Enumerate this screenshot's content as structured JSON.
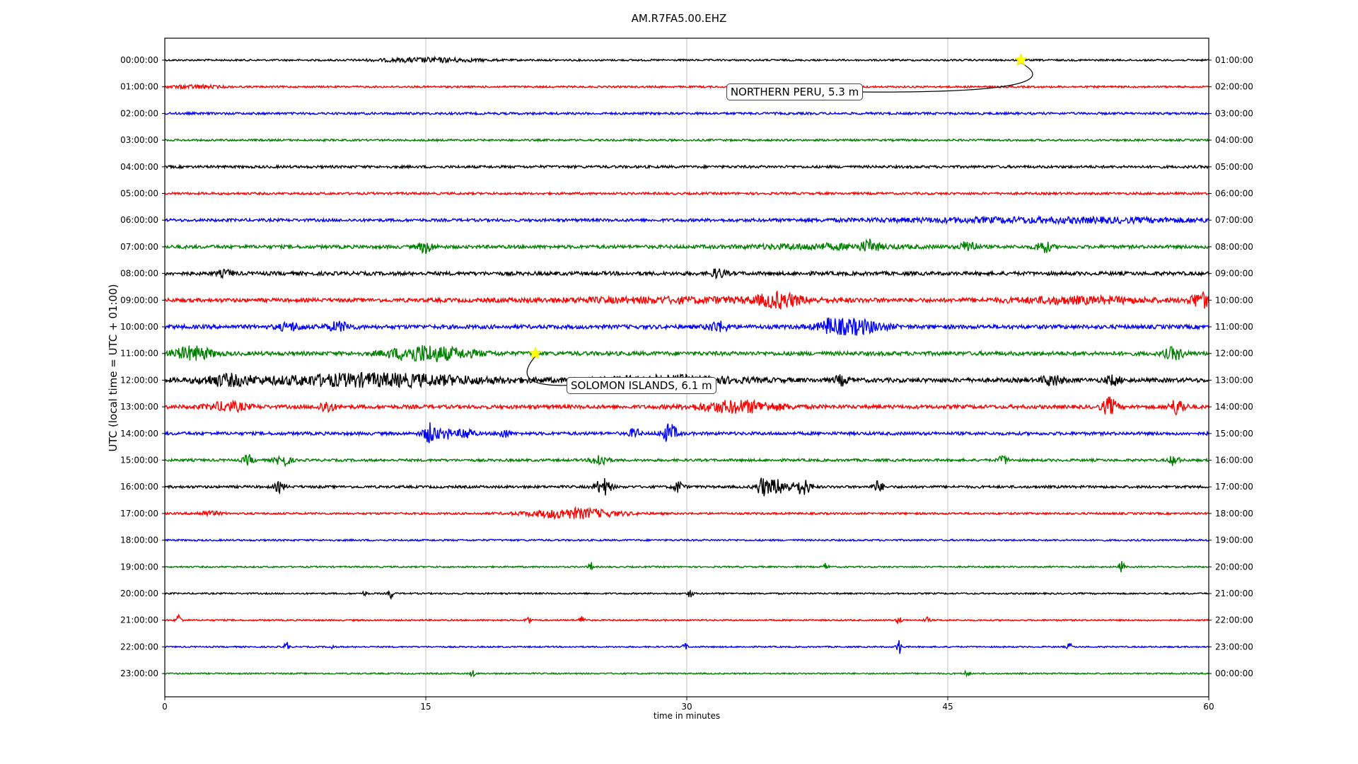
{
  "chart_data": {
    "type": "line",
    "title": "AM.R7FA5.00.EHZ",
    "xlabel": "time in minutes",
    "ylabel": "UTC (local time = UTC + 01:00)",
    "xlim": [
      0,
      60
    ],
    "xticks": [
      0,
      15,
      30,
      45,
      60
    ],
    "grid": "vertical",
    "left_labels": [
      "00:00:00",
      "01:00:00",
      "02:00:00",
      "03:00:00",
      "04:00:00",
      "05:00:00",
      "06:00:00",
      "07:00:00",
      "08:00:00",
      "09:00:00",
      "10:00:00",
      "11:00:00",
      "12:00:00",
      "13:00:00",
      "14:00:00",
      "15:00:00",
      "16:00:00",
      "17:00:00",
      "18:00:00",
      "19:00:00",
      "20:00:00",
      "21:00:00",
      "22:00:00",
      "23:00:00"
    ],
    "right_labels": [
      "01:00:00",
      "02:00:00",
      "03:00:00",
      "04:00:00",
      "05:00:00",
      "06:00:00",
      "07:00:00",
      "08:00:00",
      "09:00:00",
      "10:00:00",
      "11:00:00",
      "12:00:00",
      "13:00:00",
      "14:00:00",
      "15:00:00",
      "16:00:00",
      "17:00:00",
      "18:00:00",
      "19:00:00",
      "20:00:00",
      "21:00:00",
      "22:00:00",
      "23:00:00",
      "00:00:00"
    ],
    "trace_colors": [
      "#000000",
      "#ff0000",
      "#0000ff",
      "#008000"
    ],
    "traces": [
      {
        "noise": 1.2,
        "events": [
          [
            15.2,
            2,
            3
          ]
        ]
      },
      {
        "noise": 1.3,
        "events": [
          [
            1.8,
            1,
            2
          ]
        ]
      },
      {
        "noise": 1.6,
        "events": []
      },
      {
        "noise": 1.4,
        "events": []
      },
      {
        "noise": 1.8,
        "events": []
      },
      {
        "noise": 1.6,
        "events": []
      },
      {
        "noise": 2.0,
        "events": [
          [
            51,
            8,
            3
          ]
        ]
      },
      {
        "noise": 2.4,
        "events": [
          [
            15,
            0.3,
            8
          ],
          [
            40.5,
            0.3,
            7
          ],
          [
            46.2,
            0.3,
            9
          ],
          [
            50.5,
            0.3,
            8
          ],
          [
            38,
            3,
            3
          ]
        ]
      },
      {
        "noise": 2.6,
        "events": [
          [
            31.8,
            0.3,
            6
          ],
          [
            3.5,
            0.3,
            4
          ]
        ]
      },
      {
        "noise": 2.6,
        "events": [
          [
            35.3,
            0.8,
            9
          ],
          [
            59.6,
            0.5,
            10
          ],
          [
            52.5,
            3,
            4
          ],
          [
            30,
            6,
            3
          ]
        ]
      },
      {
        "noise": 2.8,
        "events": [
          [
            39.5,
            1.2,
            10
          ],
          [
            10,
            0.5,
            6
          ],
          [
            31.8,
            0.4,
            7
          ],
          [
            7.2,
            0.5,
            5
          ],
          [
            38.2,
            0.3,
            6
          ]
        ]
      },
      {
        "noise": 2.8,
        "events": [
          [
            1.6,
            0.8,
            9
          ],
          [
            14.5,
            1.2,
            8
          ],
          [
            16.2,
            1.5,
            5
          ],
          [
            58,
            0.4,
            8
          ]
        ]
      },
      {
        "noise": 3.0,
        "events": [
          [
            12,
            4.5,
            8
          ],
          [
            51,
            0.4,
            7
          ],
          [
            54.5,
            0.3,
            6
          ],
          [
            3.5,
            1,
            6
          ],
          [
            29,
            3,
            5
          ],
          [
            38.9,
            0.3,
            6
          ]
        ]
      },
      {
        "noise": 2.6,
        "events": [
          [
            33,
            1.7,
            8
          ],
          [
            54.3,
            0.3,
            12
          ],
          [
            58.2,
            0.3,
            11
          ],
          [
            3.6,
            0.8,
            6
          ],
          [
            9.3,
            0.3,
            8
          ]
        ]
      },
      {
        "noise": 2.2,
        "events": [
          [
            15.3,
            0.3,
            14
          ],
          [
            17.3,
            0.3,
            8
          ],
          [
            29,
            0.3,
            13
          ],
          [
            16.2,
            0.2,
            8
          ],
          [
            27,
            0.2,
            7
          ],
          [
            19.5,
            0.2,
            6
          ]
        ]
      },
      {
        "noise": 1.8,
        "events": [
          [
            6.8,
            0.3,
            8
          ],
          [
            25,
            0.3,
            9
          ],
          [
            4.8,
            0.2,
            7
          ],
          [
            58,
            0.2,
            7
          ],
          [
            48.2,
            0.2,
            6
          ]
        ]
      },
      {
        "noise": 1.8,
        "events": [
          [
            25.2,
            0.3,
            12
          ],
          [
            35.2,
            0.6,
            10
          ],
          [
            36.7,
            0.3,
            11
          ],
          [
            6.6,
            0.2,
            7
          ],
          [
            29.5,
            0.2,
            8
          ],
          [
            34.3,
            0.2,
            10
          ],
          [
            41,
            0.2,
            8
          ]
        ]
      },
      {
        "noise": 1.4,
        "events": [
          [
            23.5,
            1.8,
            7
          ],
          [
            2.5,
            0.5,
            3
          ]
        ]
      },
      {
        "noise": 1.2,
        "events": []
      },
      {
        "noise": 1.1,
        "events": [
          [
            24.5,
            0.1,
            6
          ],
          [
            38,
            0.1,
            5
          ],
          [
            55,
            0.1,
            8
          ]
        ]
      },
      {
        "noise": 1.1,
        "events": [
          [
            13,
            0.1,
            7
          ],
          [
            30.2,
            0.1,
            6
          ],
          [
            11.5,
            0.1,
            3
          ]
        ]
      },
      {
        "noise": 1.1,
        "events": [
          [
            0.8,
            0.1,
            9
          ],
          [
            24,
            0.1,
            9
          ],
          [
            20.9,
            0.1,
            7
          ],
          [
            42.2,
            0.1,
            6
          ],
          [
            43.8,
            0.1,
            4
          ]
        ]
      },
      {
        "noise": 1.0,
        "events": [
          [
            7,
            0.1,
            7
          ],
          [
            42.2,
            0.1,
            11
          ],
          [
            29.9,
            0.1,
            5
          ],
          [
            52,
            0.1,
            5
          ],
          [
            9.6,
            0.1,
            3
          ]
        ]
      },
      {
        "noise": 1.0,
        "events": [
          [
            17.7,
            0.1,
            5
          ],
          [
            46.1,
            0.1,
            5
          ]
        ]
      }
    ],
    "events": [
      {
        "label": "NORTHERN PERU, 5.3 m",
        "row": 0,
        "minute": 49.2
      },
      {
        "label": "SOLOMON ISLANDS, 6.1 m",
        "row": 11,
        "minute": 21.3
      }
    ],
    "marker_color": "#ffff00"
  }
}
